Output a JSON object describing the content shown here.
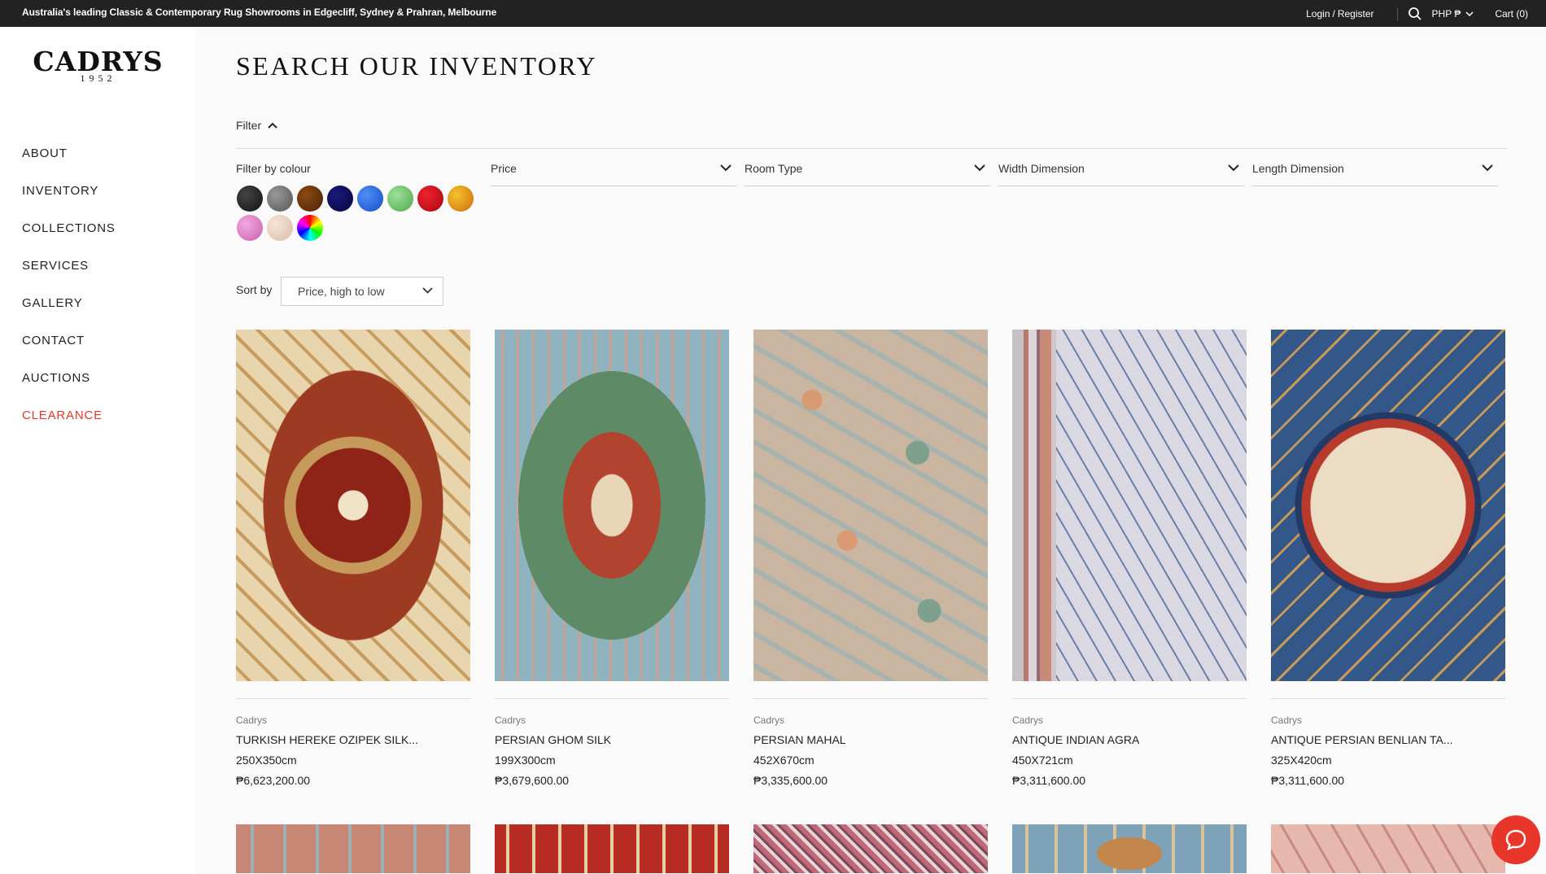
{
  "topbar": {
    "tagline": "Australia's leading Classic & Contemporary Rug Showrooms in Edgecliff, Sydney & Prahran, Melbourne",
    "login": "Login",
    "divider": "/",
    "register": "Register",
    "currency": "PHP ₱",
    "cart": "Cart (0)",
    "icons": [
      "search-icon",
      "chevron-down-icon"
    ]
  },
  "logo": {
    "name": "CADRYS",
    "year": "1952"
  },
  "nav": {
    "items": [
      {
        "label": "ABOUT"
      },
      {
        "label": "INVENTORY"
      },
      {
        "label": "COLLECTIONS"
      },
      {
        "label": "SERVICES"
      },
      {
        "label": "GALLERY"
      },
      {
        "label": "CONTACT"
      },
      {
        "label": "AUCTIONS"
      },
      {
        "label": "CLEARANCE",
        "color": "#e8372a"
      }
    ]
  },
  "page": {
    "title": "SEARCH OUR INVENTORY"
  },
  "filter": {
    "toggle_label": "Filter",
    "colour_label": "Filter by colour",
    "swatches": [
      {
        "name": "black",
        "color": "#1f1f1f"
      },
      {
        "name": "grey",
        "color": "#6e6e6e"
      },
      {
        "name": "brown",
        "color": "#6b3206"
      },
      {
        "name": "navy",
        "color": "#0b0b5c"
      },
      {
        "name": "blue",
        "color": "#1e63dd"
      },
      {
        "name": "green",
        "color": "#6fc46a"
      },
      {
        "name": "red",
        "color": "#d10a16"
      },
      {
        "name": "gold",
        "color": "#e39a12"
      },
      {
        "name": "pink",
        "color": "#df7fc3"
      },
      {
        "name": "beige",
        "color": "#ead3c2"
      },
      {
        "name": "multi",
        "color": "conic"
      }
    ],
    "dropdowns": [
      {
        "label": "Price"
      },
      {
        "label": "Room Type"
      },
      {
        "label": "Width Dimension"
      },
      {
        "label": "Length Dimension"
      }
    ]
  },
  "sort": {
    "label": "Sort by",
    "value": "Price, high to low"
  },
  "products": [
    {
      "brand": "Cadrys",
      "title": "TURKISH HEREKE OZIPEK SILK...",
      "size": "250X350cm",
      "price": "₱6,623,200.00"
    },
    {
      "brand": "Cadrys",
      "title": "PERSIAN GHOM SILK",
      "size": "199X300cm",
      "price": "₱3,679,600.00"
    },
    {
      "brand": "Cadrys",
      "title": "PERSIAN MAHAL",
      "size": "452X670cm",
      "price": "₱3,335,600.00"
    },
    {
      "brand": "Cadrys",
      "title": "ANTIQUE INDIAN AGRA",
      "size": "450X721cm",
      "price": "₱3,311,600.00"
    },
    {
      "brand": "Cadrys",
      "title": "ANTIQUE PERSIAN BENLIAN TA...",
      "size": "325X420cm",
      "price": "₱3,311,600.00"
    }
  ],
  "chat": {
    "icon": "chat-icon",
    "color": "#e8372a"
  }
}
